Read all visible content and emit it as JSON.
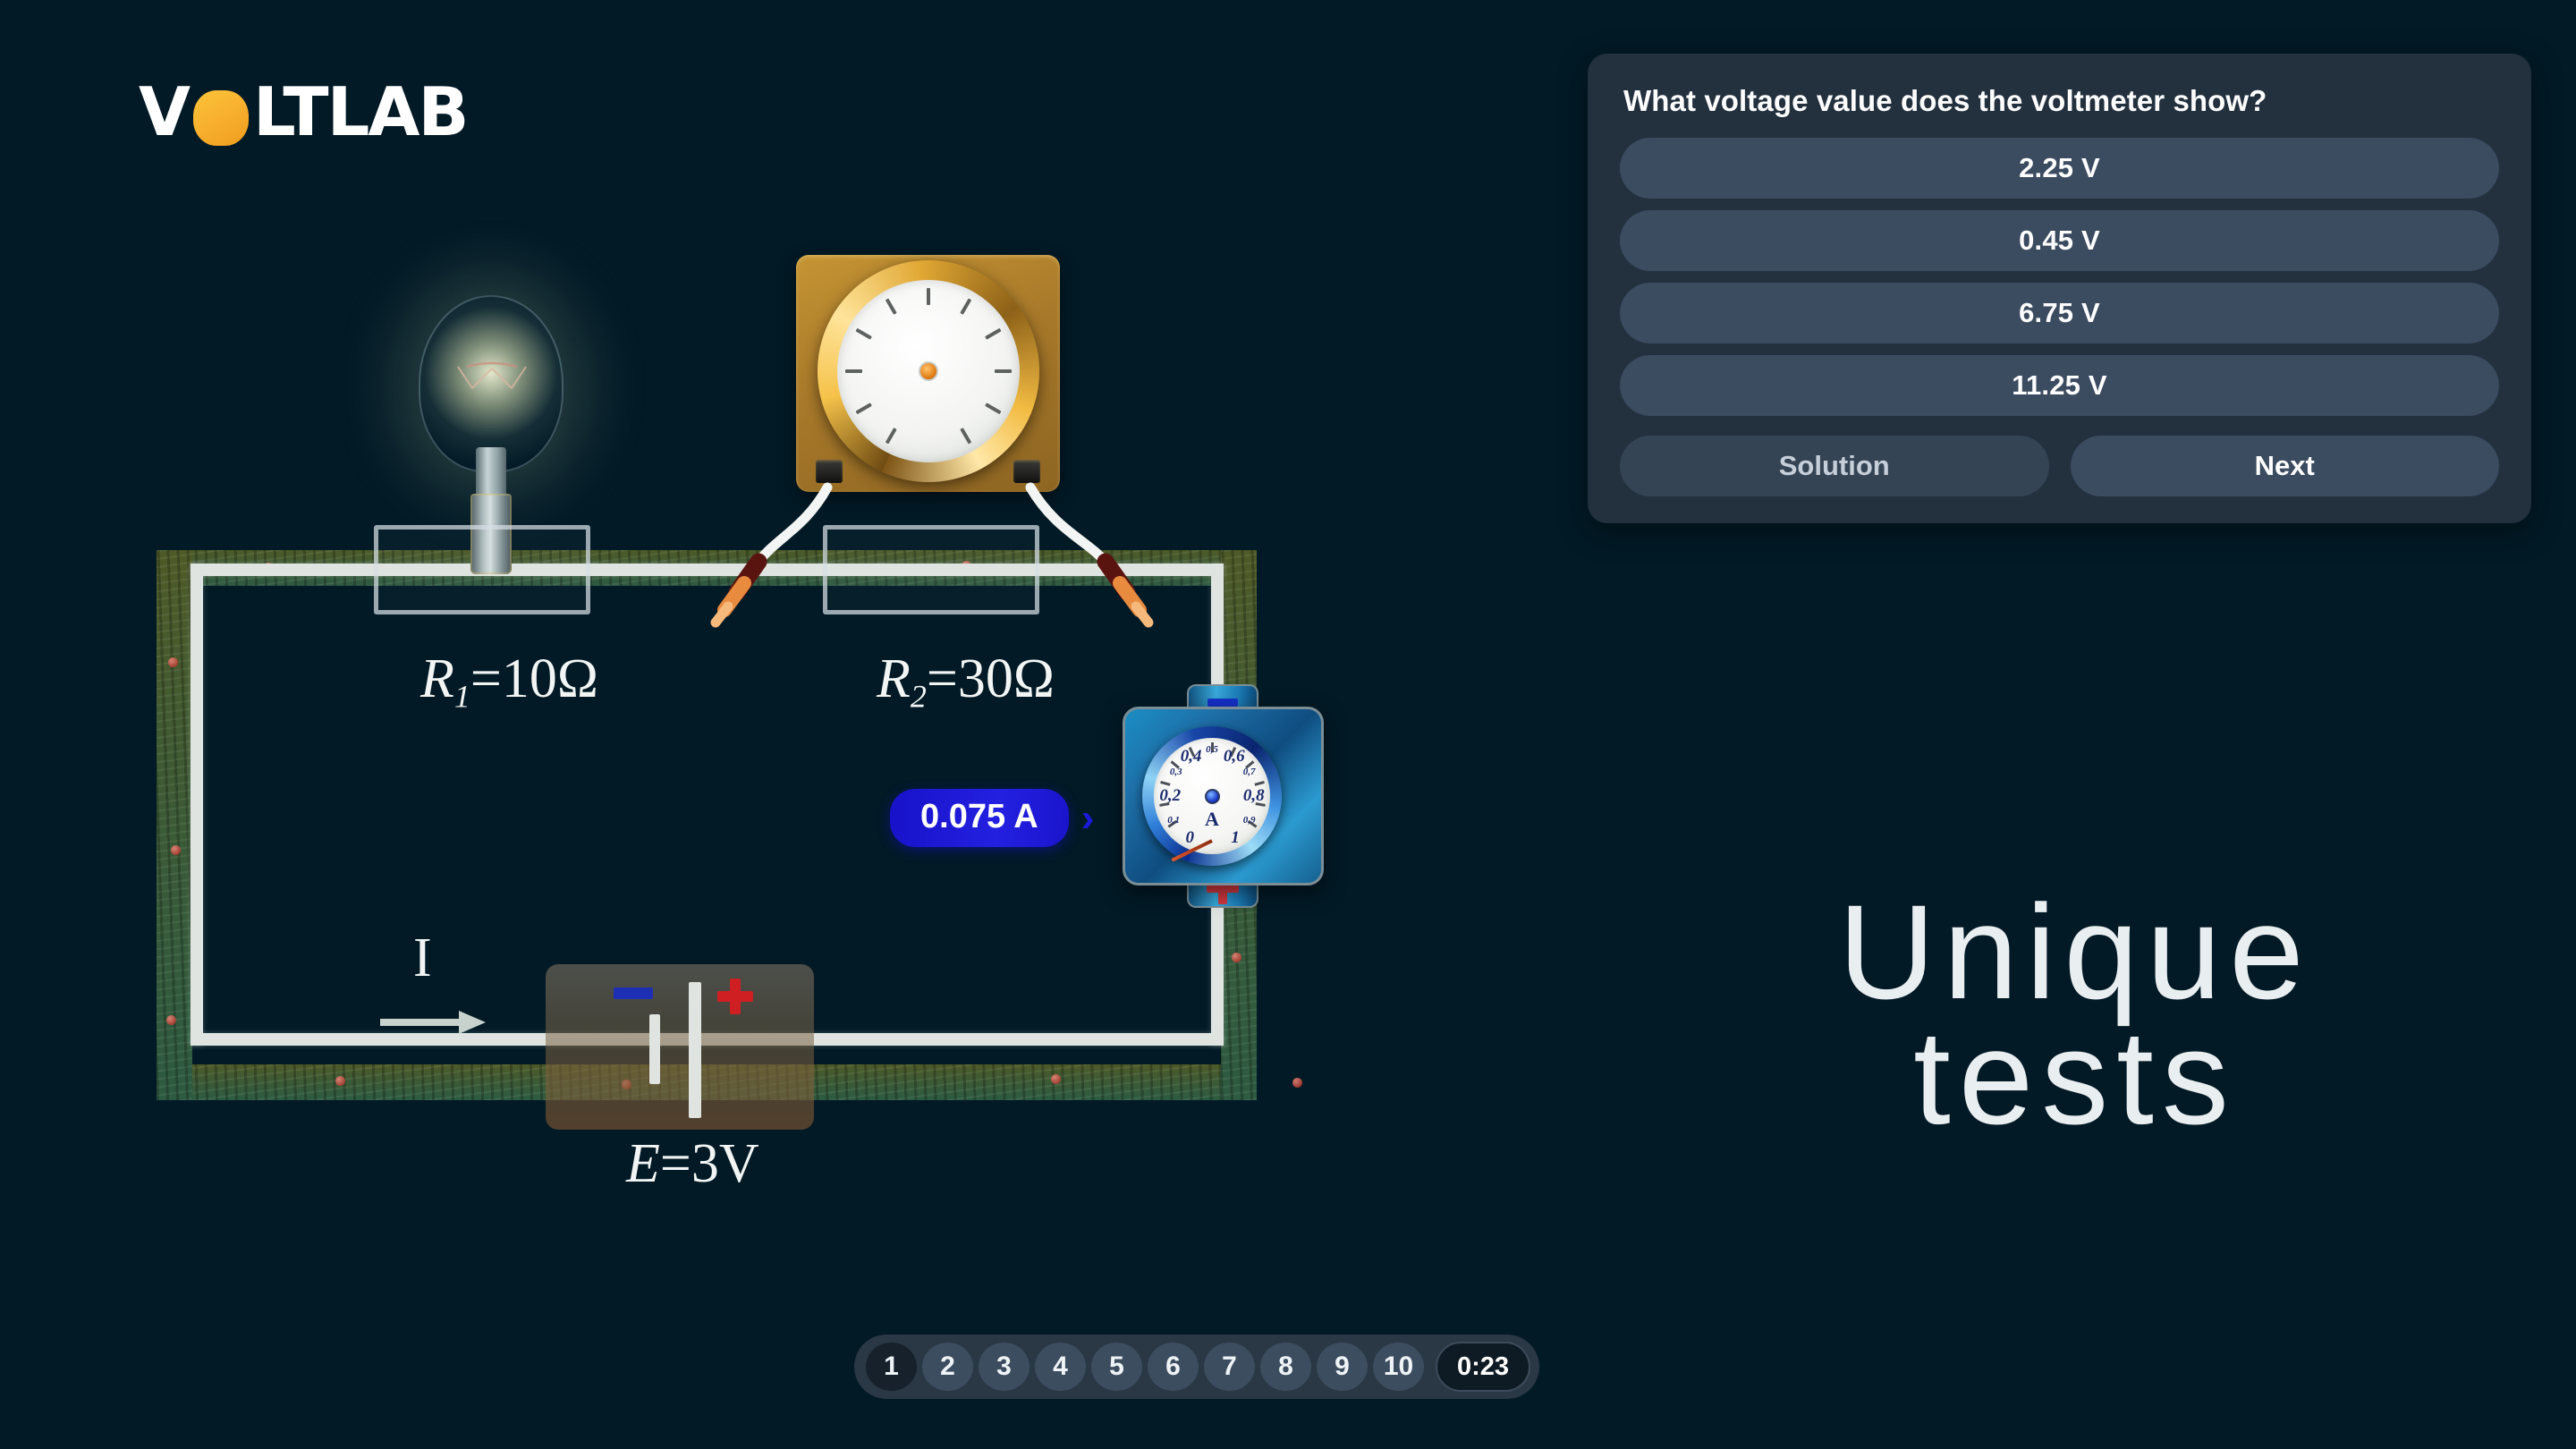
{
  "brand": {
    "name_before": "V",
    "logo_o": "O",
    "name_after": "LTLAB",
    "accent": "#f7b32b"
  },
  "tagline": {
    "line1": "Unique",
    "line2": "tests"
  },
  "quiz": {
    "question": "What voltage value does the voltmeter show?",
    "answers": [
      "2.25 V",
      "0.45 V",
      "6.75 V",
      "11.25 V"
    ],
    "solution_label": "Solution",
    "next_label": "Next"
  },
  "pager": {
    "pages": [
      "1",
      "2",
      "3",
      "4",
      "5",
      "6",
      "7",
      "8",
      "9",
      "10"
    ],
    "active": "1",
    "timer": "0:23"
  },
  "circuit": {
    "resistor1": {
      "symbol": "R",
      "sub": "1",
      "eq": "=10",
      "unit": "Ω"
    },
    "resistor2": {
      "symbol": "R",
      "sub": "2",
      "eq": "=30",
      "unit": "Ω"
    },
    "emf": {
      "symbol": "E",
      "eq": "=3",
      "unit": "V"
    },
    "current_symbol": "I",
    "current_badge": "0.075 A",
    "badge_arrow": "›",
    "battery_minus": "−",
    "battery_plus": "+"
  },
  "ammeter": {
    "unit": "A",
    "major_labels": [
      "0",
      "0,2",
      "0,4",
      "0,6",
      "0,8",
      "1"
    ],
    "minor_labels": [
      "0,1",
      "0,3",
      "0,5",
      "0,7",
      "0,9"
    ],
    "reading": "0.075",
    "terminal_minus": "−",
    "terminal_plus": "+"
  },
  "voltmeter": {
    "reading": ""
  }
}
